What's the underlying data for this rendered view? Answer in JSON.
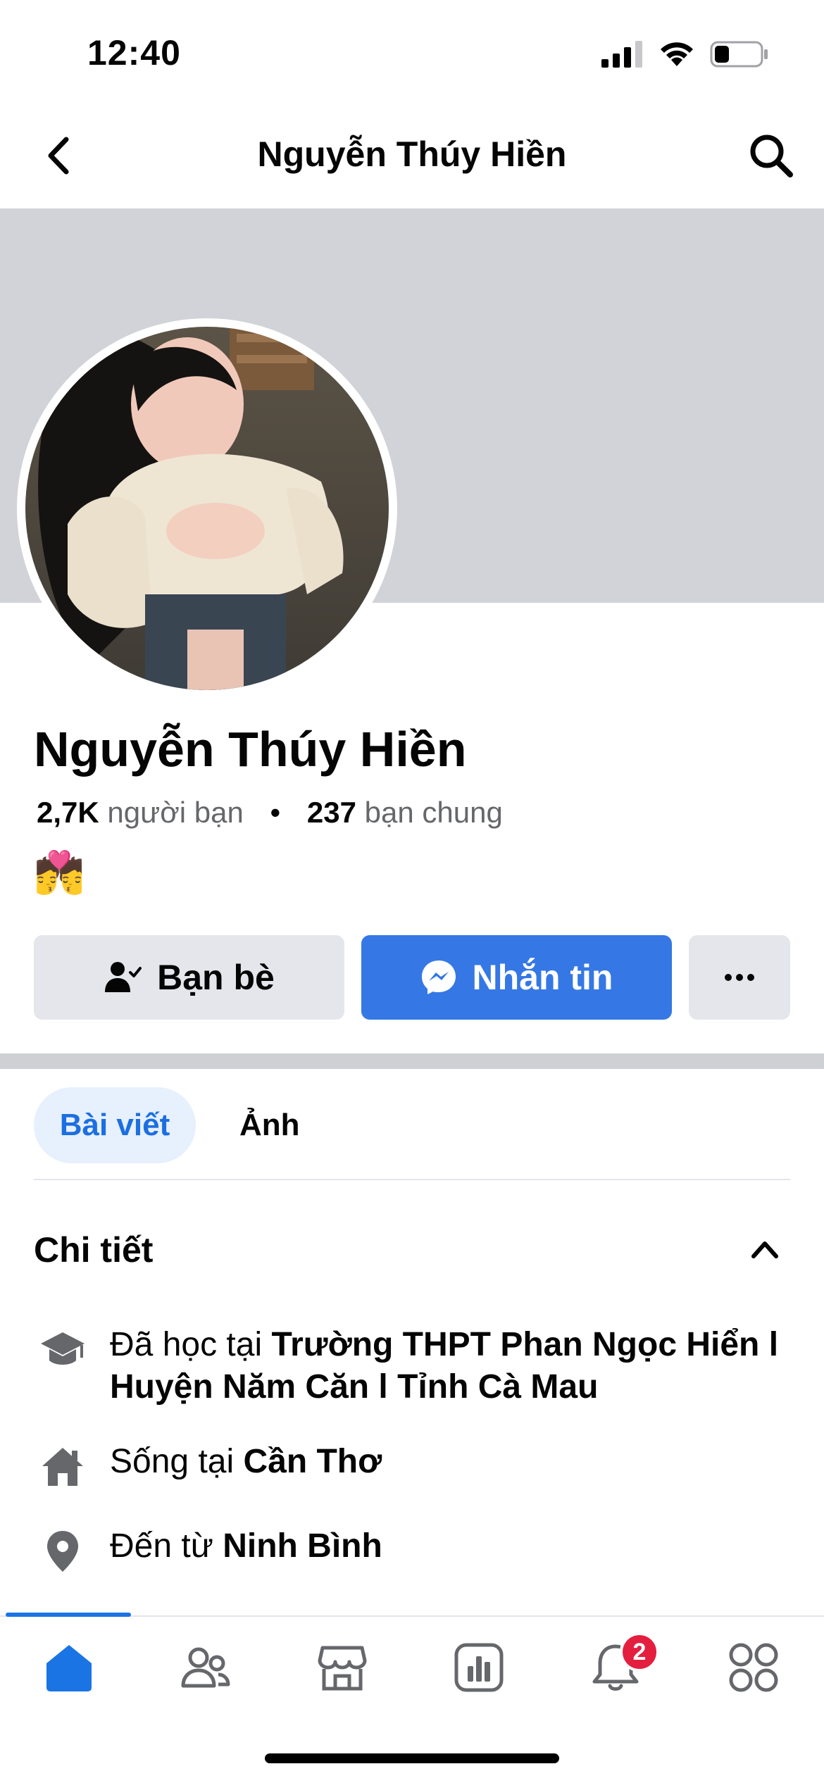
{
  "status_bar": {
    "time": "12:40",
    "icons": [
      "signal-icon",
      "wifi-icon",
      "battery-icon"
    ]
  },
  "header": {
    "title": "Nguyễn Thúy Hiền",
    "back_icon": "chevron-left-icon",
    "search_icon": "search-icon"
  },
  "profile": {
    "name": "Nguyễn Thúy Hiền",
    "friends_count": "2,7K",
    "friends_label": "người bạn",
    "separator": "•",
    "mutual_count": "237",
    "mutual_label": "bạn chung",
    "emoji": "💏"
  },
  "actions": {
    "friends_label": "Bạn bè",
    "message_label": "Nhắn tin",
    "more_icon": "more-horizontal-icon"
  },
  "tabs": [
    {
      "label": "Bài viết",
      "active": true
    },
    {
      "label": "Ảnh",
      "active": false
    }
  ],
  "details": {
    "title": "Chi tiết",
    "items": [
      {
        "icon": "graduation-cap-icon",
        "prefix": "Đã học tại ",
        "value": "Trường THPT Phan Ngọc Hiển l Huyện Năm Căn l Tỉnh Cà Mau"
      },
      {
        "icon": "home-icon",
        "prefix": "Sống tại ",
        "value": "Cần Thơ"
      },
      {
        "icon": "location-pin-icon",
        "prefix": "Đến từ ",
        "value": "Ninh Bình"
      }
    ]
  },
  "bottom_nav": {
    "items": [
      "home-icon",
      "friends-icon",
      "marketplace-icon",
      "dashboard-icon",
      "notifications-icon",
      "menu-icon"
    ],
    "notification_badge": "2"
  },
  "colors": {
    "accent": "#3578e5",
    "cover": "#d1d3d8",
    "button_gray": "#e4e6eb",
    "badge": "#e41e3f"
  }
}
